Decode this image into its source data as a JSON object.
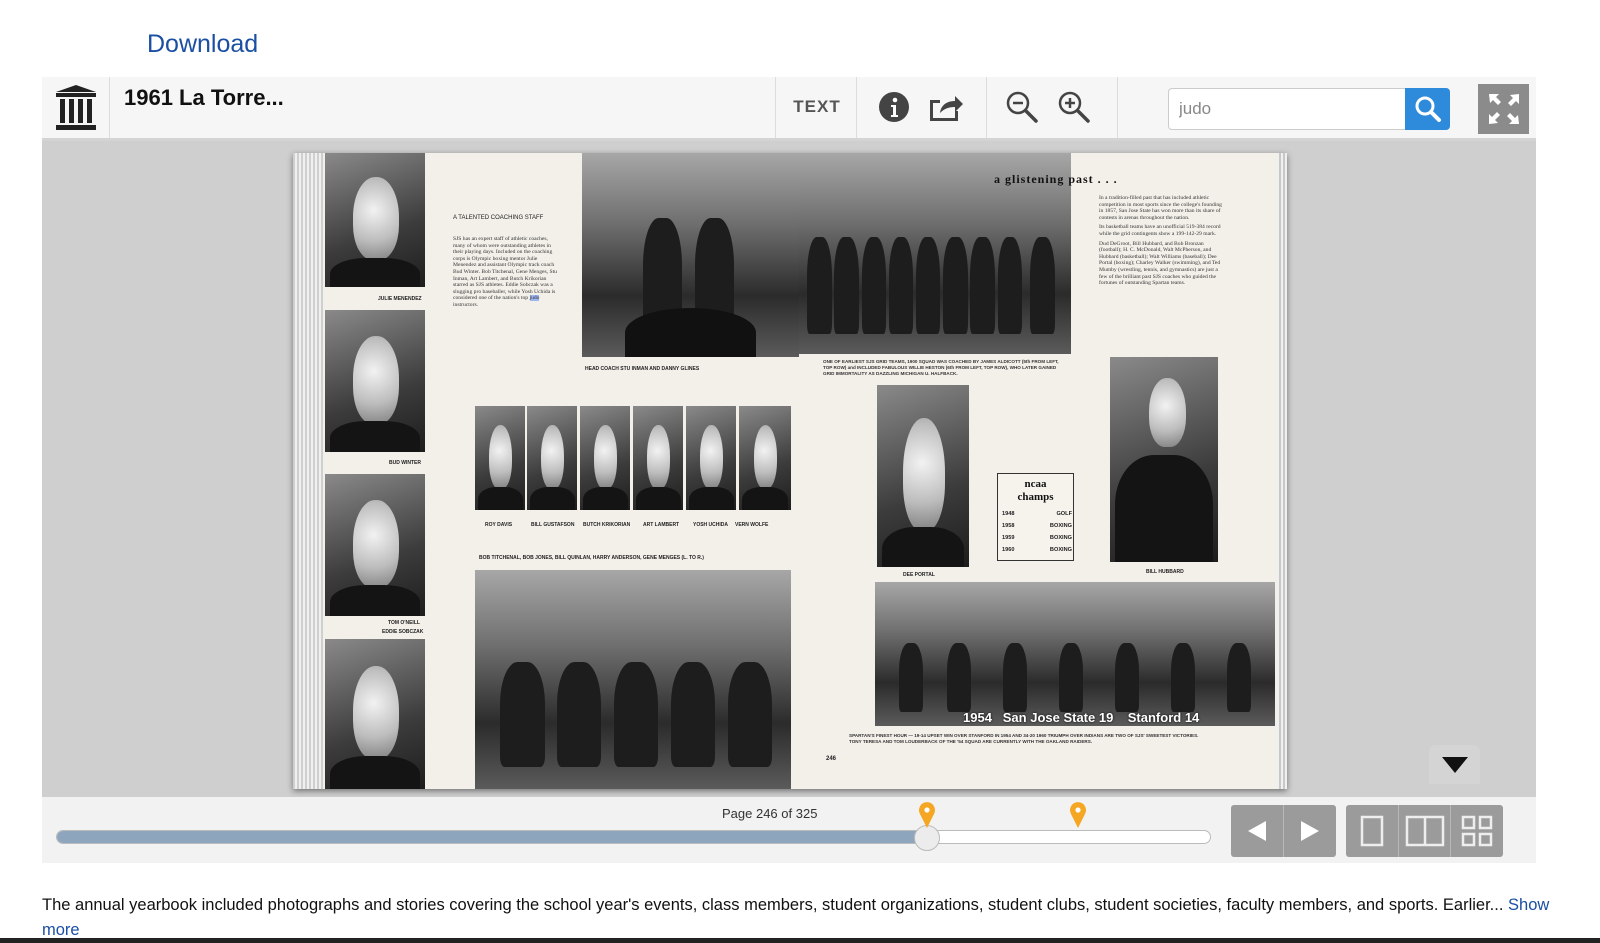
{
  "header": {
    "download_label": "Download"
  },
  "toolbar": {
    "title": "1961 La Torre...",
    "text_label": "TEXT",
    "search_value": "judo"
  },
  "book": {
    "left_captions": {
      "portrait1": "JULIE MENENDEZ",
      "portrait2": "BUD WINTER",
      "portrait3a": "TOM O'NEILL",
      "portrait3b": "EDDIE SOBCZAK"
    },
    "coaching_heading": "A TALENTED COACHING STAFF",
    "coaching_text_before": "SJS has an expert staff of athletic coaches, many of whom were outstanding athletes in their playing days. Included on the coaching corps is Olympic boxing mentor Julie Menendez and assistant Olympic track coach Bud Winter. Bob Titchenal, Gene Menges, Stu Inman, Art Lambert, and Butch Krikorian starred as SJS athletes. Eddie Sobczak was a slugging pro baseballer, while Yosh Uchida is considered one of the nation's top",
    "coaching_highlight": "judo",
    "coaching_text_after": "instructors.",
    "head_coach_caption": "HEAD COACH STU INMAN AND DANNY GLINES",
    "row_names": [
      "ROY DAVIS",
      "BILL GUSTAFSON",
      "BUTCH KRIKORIAN",
      "ART LAMBERT",
      "YOSH UCHIDA",
      "VERN WOLFE"
    ],
    "group_caption": "BOB TITCHENAL, BOB JONES, BILL QUINLAN, HARRY ANDERSON, GENE MENGES (L. TO R.)",
    "glisten_title": "a glistening past . . .",
    "glisten_p1": "In a tradition-filled past that has included athletic competition in most sports since the college's founding in 1857, San Jose State has won more than its share of contests in arenas throughout the nation.",
    "glisten_p2": "Its basketball teams have an unofficial 519-384 record while the grid contingents show a 199-142-29 mark.",
    "glisten_p3": "Dud DeGroot, Bill Hubbard, and Bob Bronzan (football); H. C. McDonald, Walt McPherson, and Hubbard (basketball); Walt Williams (baseball); Dee Portal (boxing); Charley Walker (swimming), and Ted Mumby (wrestling, tennis, and gymnastics) are just a few of the brilliant past SJS coaches who guided the fortunes of outstanding Spartan teams.",
    "grid_caption": "ONE OF EARLIEST SJS GRID TEAMS, 1900 SQUAD WAS COACHED BY JAMES ALDICOTT (5th FROM LEFT, TOP ROW) and INCLUDED FABULOUS WILLIE HESTON (6th FROM LEFT, TOP ROW), WHO LATER GAINED GRID IMMORTALITY AS DAZZLING MICHIGAN U. HALFBACK.",
    "dee_caption": "DEE PORTAL",
    "hubbard_caption": "BILL HUBBARD",
    "ncaa_title_1": "ncaa",
    "ncaa_title_2": "champs",
    "ncaa_rows": [
      {
        "year": "1948",
        "sport": "GOLF"
      },
      {
        "year": "1958",
        "sport": "BOXING"
      },
      {
        "year": "1959",
        "sport": "BOXING"
      },
      {
        "year": "1960",
        "sport": "BOXING"
      }
    ],
    "score_text": "1954   San Jose State 19    Stanford 14",
    "finest_caption_1": "SPARTAN'S FINEST HOUR — 19-14 UPSET WIN OVER STANFORD IN 1954 AND 34-20 1960 TRIUMPH OVER INDIANS ARE TWO OF SJS' SWEETEST VICTORIES.",
    "finest_caption_2": "TONY TERESA AND TOM LOUDERBACK OF THE '54 SQUAD ARE CURRENTLY WITH THE OAKLAND RAIDERS.",
    "page_number": "246"
  },
  "navigation": {
    "page_label": "Page 246 of 325",
    "current_page": 246,
    "total_pages": 325,
    "progress_fraction": 0.754,
    "search_marker_fractions": [
      0.754,
      0.885
    ]
  },
  "description": {
    "text": "The annual yearbook included photographs and stories covering the school year's events, class members, student organizations, student clubs, student societies, faculty members, and sports. Earlier...",
    "show_more_label": "Show more"
  },
  "colors": {
    "accent_blue": "#2e8adb",
    "link_blue": "#1a4fa3",
    "marker_orange": "#f5a623",
    "slider_fill": "#8ea6bd"
  },
  "icons": [
    "library-logo-icon",
    "info-icon",
    "share-icon",
    "zoom-out-icon",
    "zoom-in-icon",
    "search-icon",
    "fullscreen-icon",
    "chevron-down-icon",
    "arrow-left-icon",
    "arrow-right-icon",
    "one-page-view-icon",
    "two-page-view-icon",
    "thumbnail-view-icon"
  ]
}
